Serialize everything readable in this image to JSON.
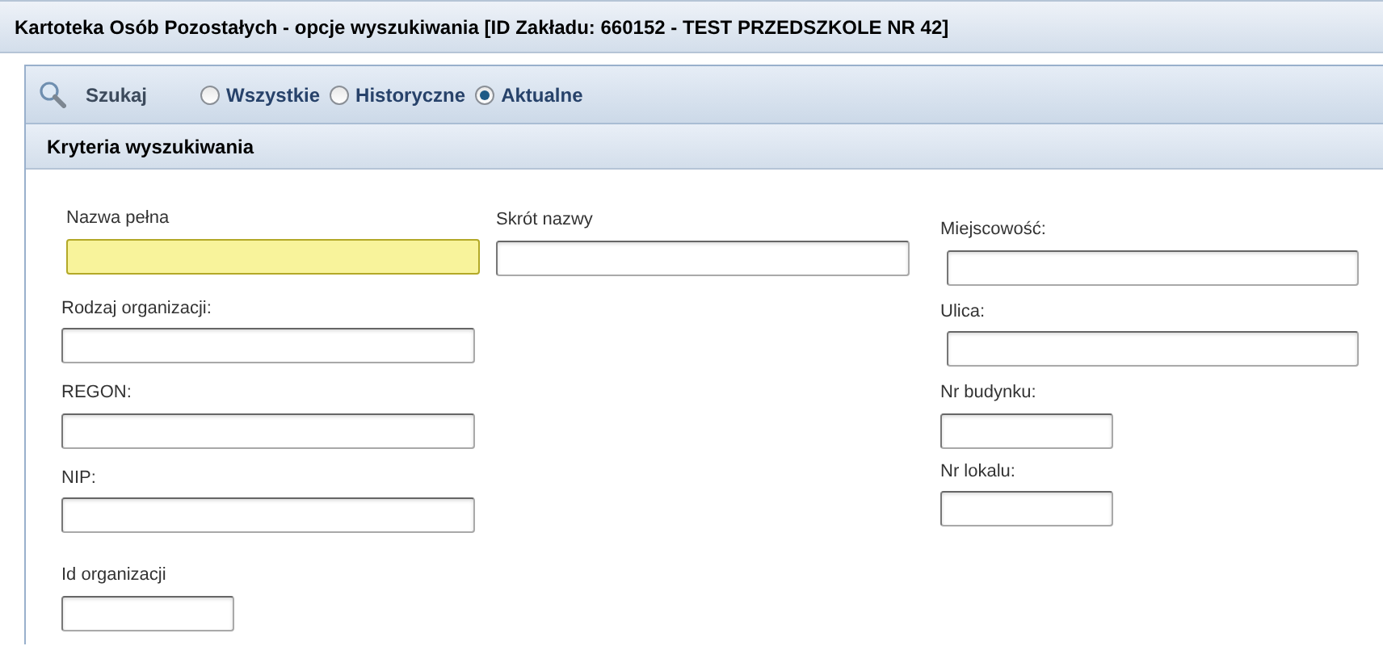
{
  "window": {
    "title": "Kartoteka Osób Pozostałych - opcje wyszukiwania [ID Zakładu: 660152 - TEST PRZEDSZKOLE NR 42]"
  },
  "toolbar": {
    "search_label": "Szukaj",
    "filter": [
      {
        "label": "Wszystkie",
        "selected": false
      },
      {
        "label": "Historyczne",
        "selected": false
      },
      {
        "label": "Aktualne",
        "selected": true
      }
    ]
  },
  "section": {
    "title": "Kryteria wyszukiwania"
  },
  "columns": [
    [
      {
        "label": "Nazwa pełna",
        "kind": "wide",
        "focused": true
      },
      {
        "label": "Rodzaj organizacji:",
        "kind": "wide",
        "focused": false
      },
      {
        "label": "REGON:",
        "kind": "wide",
        "focused": false
      },
      {
        "label": "NIP:",
        "kind": "wide",
        "focused": false
      },
      {
        "label": "Id organizacji",
        "kind": "short",
        "focused": false
      }
    ],
    [
      {
        "label": "Skrót nazwy",
        "kind": "wide",
        "focused": false
      }
    ],
    [
      {
        "label": "Miejscowość:",
        "kind": "wide",
        "focused": false
      },
      {
        "label": "Ulica:",
        "kind": "wide",
        "focused": false
      },
      {
        "label": "Nr budynku:",
        "kind": "short",
        "focused": false
      },
      {
        "label": "Nr lokalu:",
        "kind": "short",
        "focused": false
      }
    ]
  ]
}
